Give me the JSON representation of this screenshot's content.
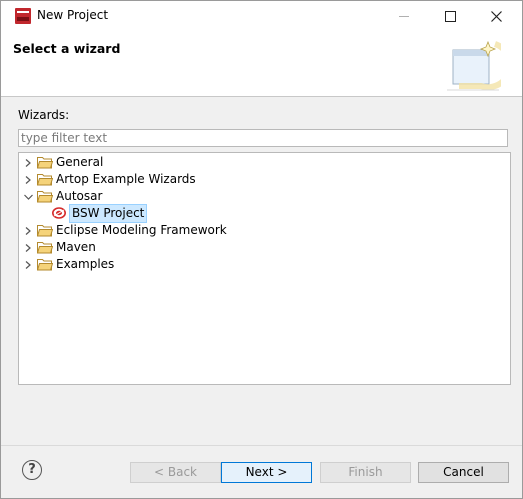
{
  "window": {
    "title": "New Project"
  },
  "banner": {
    "title": "Select a wizard"
  },
  "filter": {
    "label": "Wizards:",
    "placeholder": "type filter text",
    "value": ""
  },
  "tree": {
    "items": [
      {
        "label": "General",
        "expanded": false
      },
      {
        "label": "Artop Example Wizards",
        "expanded": false
      },
      {
        "label": "Autosar",
        "expanded": true
      },
      {
        "label": "BSW Project",
        "selected": true
      },
      {
        "label": "Eclipse Modeling Framework",
        "expanded": false
      },
      {
        "label": "Maven",
        "expanded": false
      },
      {
        "label": "Examples",
        "expanded": false
      }
    ]
  },
  "buttons": {
    "help": "?",
    "back": "< Back",
    "next": "Next >",
    "finish": "Finish",
    "cancel": "Cancel"
  },
  "colors": {
    "selection_bg": "#cce8ff",
    "selection_border": "#99d1ff",
    "default_button_border": "#0078d7",
    "folder_fill": "#f5d37a",
    "app_icon": "#c1272d"
  }
}
